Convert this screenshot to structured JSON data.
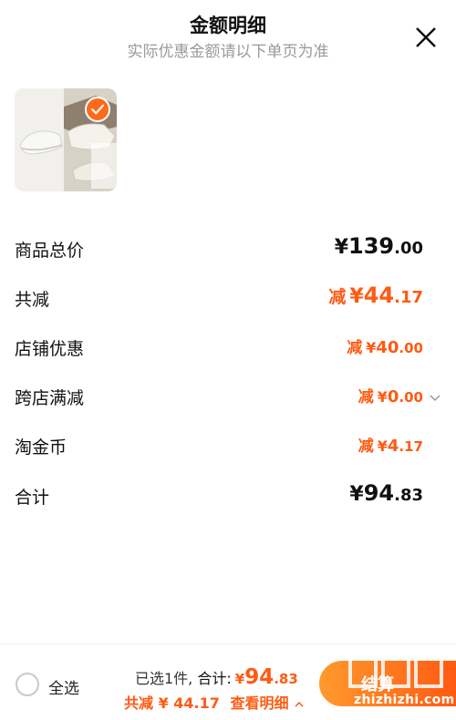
{
  "header": {
    "title": "金额明细",
    "subtitle": "实际优惠金额请以下单页为准",
    "close_icon": "close-icon"
  },
  "product": {
    "selected": true,
    "check_icon": "check-icon"
  },
  "rows": {
    "goods_total": {
      "label": "商品总价",
      "cur": "¥",
      "int": "139",
      "dec": ".00"
    },
    "total_reduction": {
      "label": "共减",
      "prefix": "减",
      "cur": "¥",
      "int": "44",
      "dec": ".17"
    },
    "shop_discount": {
      "label": "店铺优惠",
      "prefix": "减",
      "cur": "¥",
      "int": "40",
      "dec": ".00"
    },
    "cross_shop": {
      "label": "跨店满减",
      "prefix": "减",
      "cur": "¥",
      "int": "0",
      "dec": ".00",
      "icon": "chevron-down-icon"
    },
    "taojinbi": {
      "label": "淘金币",
      "prefix": "减",
      "cur": "¥",
      "int": "4",
      "dec": ".17"
    },
    "total": {
      "label": "合计",
      "cur": "¥",
      "int": "94",
      "dec": ".83"
    }
  },
  "footer": {
    "select_all": "全选",
    "selected_count": "已选1件,",
    "total_label": "合计:",
    "total_cur": "¥",
    "total_int": "94",
    "total_dec": ".83",
    "reduction_text": "共减 ¥ 44.17",
    "detail_link": "查看明细",
    "detail_icon": "chevron-up-icon",
    "checkout": "结算"
  },
  "watermark": {
    "text": "zhizhizhi.com"
  },
  "colors": {
    "accent": "#ff5a12",
    "gradient_start": "#ff9a2e",
    "muted": "#9a9a9a"
  }
}
